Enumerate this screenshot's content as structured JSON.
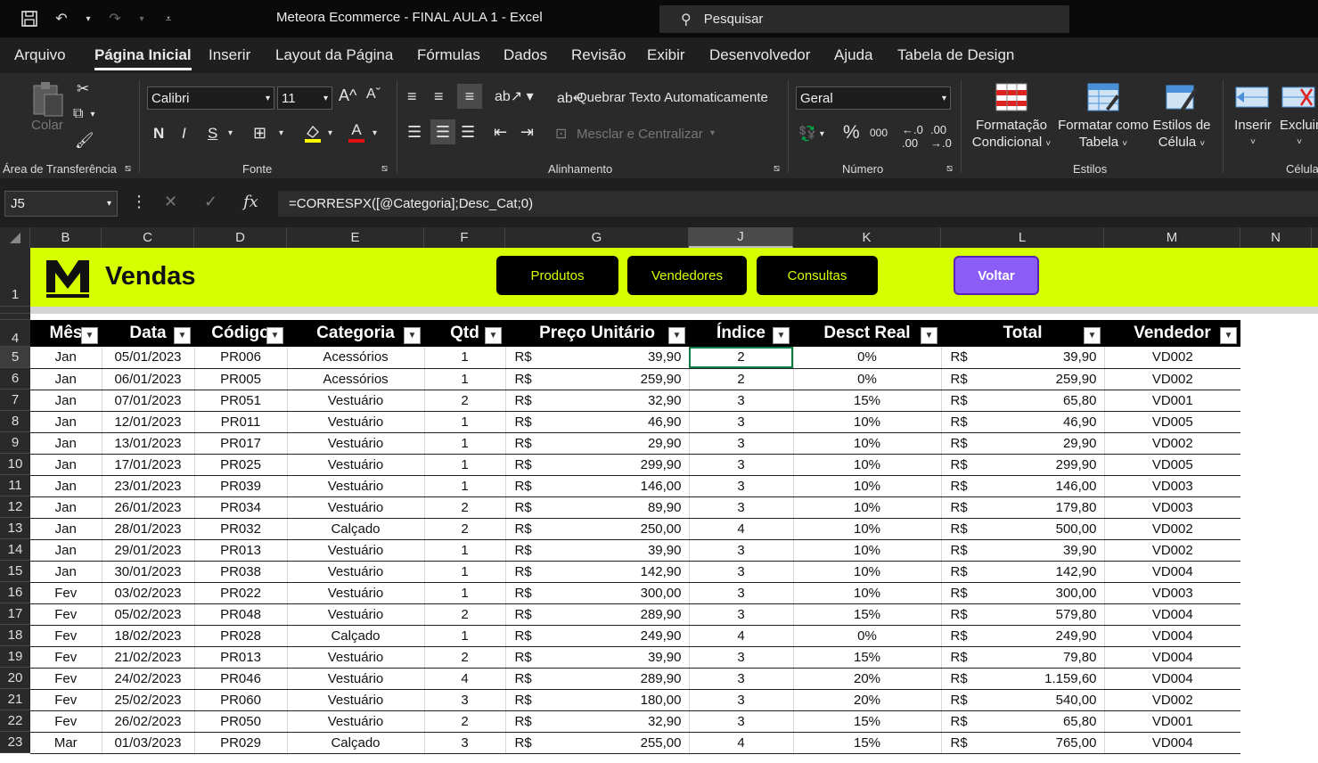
{
  "window": {
    "title": "Meteora Ecommerce - FINAL AULA 1  -  Excel",
    "search_placeholder": "Pesquisar"
  },
  "menu": {
    "tabs": [
      "Arquivo",
      "Página Inicial",
      "Inserir",
      "Layout da Página",
      "Fórmulas",
      "Dados",
      "Revisão",
      "Exibir",
      "Desenvolvedor",
      "Ajuda",
      "Tabela de Design"
    ],
    "active": "Página Inicial"
  },
  "ribbon": {
    "clipboard": {
      "paste_label": "Colar",
      "group_label": "Área de Transferência"
    },
    "font": {
      "family": "Calibri",
      "size": "11",
      "group_label": "Fonte",
      "bold": "N",
      "italic": "I",
      "underline": "S",
      "font_color_letter": "A"
    },
    "alignment": {
      "wrap_text": "Quebrar Texto Automaticamente",
      "merge_center": "Mesclar e Centralizar",
      "group_label": "Alinhamento"
    },
    "number": {
      "format": "Geral",
      "group_label": "Número",
      "percent": "%",
      "thousands": "000"
    },
    "styles": {
      "conditional": [
        "Formatação",
        "Condicional"
      ],
      "format_table": [
        "Formatar como",
        "Tabela"
      ],
      "cell_styles": [
        "Estilos de",
        "Célula"
      ],
      "group_label": "Estilos"
    },
    "cells": {
      "insert": "Inserir",
      "delete": "Excluir",
      "group_label": "Célula"
    }
  },
  "formula_bar": {
    "name_box": "J5",
    "fx": "fx",
    "formula": "=CORRESPX([@Categoria];Desc_Cat;0)"
  },
  "columns": [
    "B",
    "C",
    "D",
    "E",
    "F",
    "G",
    "J",
    "K",
    "L",
    "M",
    "N"
  ],
  "selected_column": "J",
  "banner": {
    "title": "Vendas",
    "buttons": [
      "Produtos",
      "Vendedores",
      "Consultas"
    ],
    "back_button": "Voltar"
  },
  "table": {
    "headers": [
      "Mês",
      "Data",
      "Código",
      "Categoria",
      "Qtd",
      "Preço Unitário",
      "Índice",
      "Desct Real",
      "Total",
      "Vendedor"
    ],
    "currency": "R$",
    "rows": [
      {
        "n": "5",
        "mes": "Jan",
        "data": "05/01/2023",
        "cod": "PR006",
        "cat": "Acessórios",
        "qtd": "1",
        "preco": "39,90",
        "idx": "2",
        "desc": "0%",
        "total": "39,90",
        "vend": "VD002"
      },
      {
        "n": "6",
        "mes": "Jan",
        "data": "06/01/2023",
        "cod": "PR005",
        "cat": "Acessórios",
        "qtd": "1",
        "preco": "259,90",
        "idx": "2",
        "desc": "0%",
        "total": "259,90",
        "vend": "VD002"
      },
      {
        "n": "7",
        "mes": "Jan",
        "data": "07/01/2023",
        "cod": "PR051",
        "cat": "Vestuário",
        "qtd": "2",
        "preco": "32,90",
        "idx": "3",
        "desc": "15%",
        "total": "65,80",
        "vend": "VD001"
      },
      {
        "n": "8",
        "mes": "Jan",
        "data": "12/01/2023",
        "cod": "PR011",
        "cat": "Vestuário",
        "qtd": "1",
        "preco": "46,90",
        "idx": "3",
        "desc": "10%",
        "total": "46,90",
        "vend": "VD005"
      },
      {
        "n": "9",
        "mes": "Jan",
        "data": "13/01/2023",
        "cod": "PR017",
        "cat": "Vestuário",
        "qtd": "1",
        "preco": "29,90",
        "idx": "3",
        "desc": "10%",
        "total": "29,90",
        "vend": "VD002"
      },
      {
        "n": "10",
        "mes": "Jan",
        "data": "17/01/2023",
        "cod": "PR025",
        "cat": "Vestuário",
        "qtd": "1",
        "preco": "299,90",
        "idx": "3",
        "desc": "10%",
        "total": "299,90",
        "vend": "VD005"
      },
      {
        "n": "11",
        "mes": "Jan",
        "data": "23/01/2023",
        "cod": "PR039",
        "cat": "Vestuário",
        "qtd": "1",
        "preco": "146,00",
        "idx": "3",
        "desc": "10%",
        "total": "146,00",
        "vend": "VD003"
      },
      {
        "n": "12",
        "mes": "Jan",
        "data": "26/01/2023",
        "cod": "PR034",
        "cat": "Vestuário",
        "qtd": "2",
        "preco": "89,90",
        "idx": "3",
        "desc": "10%",
        "total": "179,80",
        "vend": "VD003"
      },
      {
        "n": "13",
        "mes": "Jan",
        "data": "28/01/2023",
        "cod": "PR032",
        "cat": "Calçado",
        "qtd": "2",
        "preco": "250,00",
        "idx": "4",
        "desc": "10%",
        "total": "500,00",
        "vend": "VD002"
      },
      {
        "n": "14",
        "mes": "Jan",
        "data": "29/01/2023",
        "cod": "PR013",
        "cat": "Vestuário",
        "qtd": "1",
        "preco": "39,90",
        "idx": "3",
        "desc": "10%",
        "total": "39,90",
        "vend": "VD002"
      },
      {
        "n": "15",
        "mes": "Jan",
        "data": "30/01/2023",
        "cod": "PR038",
        "cat": "Vestuário",
        "qtd": "1",
        "preco": "142,90",
        "idx": "3",
        "desc": "10%",
        "total": "142,90",
        "vend": "VD004"
      },
      {
        "n": "16",
        "mes": "Fev",
        "data": "03/02/2023",
        "cod": "PR022",
        "cat": "Vestuário",
        "qtd": "1",
        "preco": "300,00",
        "idx": "3",
        "desc": "10%",
        "total": "300,00",
        "vend": "VD003"
      },
      {
        "n": "17",
        "mes": "Fev",
        "data": "05/02/2023",
        "cod": "PR048",
        "cat": "Vestuário",
        "qtd": "2",
        "preco": "289,90",
        "idx": "3",
        "desc": "15%",
        "total": "579,80",
        "vend": "VD004"
      },
      {
        "n": "18",
        "mes": "Fev",
        "data": "18/02/2023",
        "cod": "PR028",
        "cat": "Calçado",
        "qtd": "1",
        "preco": "249,90",
        "idx": "4",
        "desc": "0%",
        "total": "249,90",
        "vend": "VD004"
      },
      {
        "n": "19",
        "mes": "Fev",
        "data": "21/02/2023",
        "cod": "PR013",
        "cat": "Vestuário",
        "qtd": "2",
        "preco": "39,90",
        "idx": "3",
        "desc": "15%",
        "total": "79,80",
        "vend": "VD004"
      },
      {
        "n": "20",
        "mes": "Fev",
        "data": "24/02/2023",
        "cod": "PR046",
        "cat": "Vestuário",
        "qtd": "4",
        "preco": "289,90",
        "idx": "3",
        "desc": "20%",
        "total": "1.159,60",
        "vend": "VD004"
      },
      {
        "n": "21",
        "mes": "Fev",
        "data": "25/02/2023",
        "cod": "PR060",
        "cat": "Vestuário",
        "qtd": "3",
        "preco": "180,00",
        "idx": "3",
        "desc": "20%",
        "total": "540,00",
        "vend": "VD002"
      },
      {
        "n": "22",
        "mes": "Fev",
        "data": "26/02/2023",
        "cod": "PR050",
        "cat": "Vestuário",
        "qtd": "2",
        "preco": "32,90",
        "idx": "3",
        "desc": "15%",
        "total": "65,80",
        "vend": "VD001"
      },
      {
        "n": "23",
        "mes": "Mar",
        "data": "01/03/2023",
        "cod": "PR029",
        "cat": "Calçado",
        "qtd": "3",
        "preco": "255,00",
        "idx": "4",
        "desc": "15%",
        "total": "765,00",
        "vend": "VD004"
      }
    ]
  },
  "colors": {
    "banner": "#d6ff00",
    "back_button": "#8b5cf6",
    "selection": "#107c41"
  }
}
